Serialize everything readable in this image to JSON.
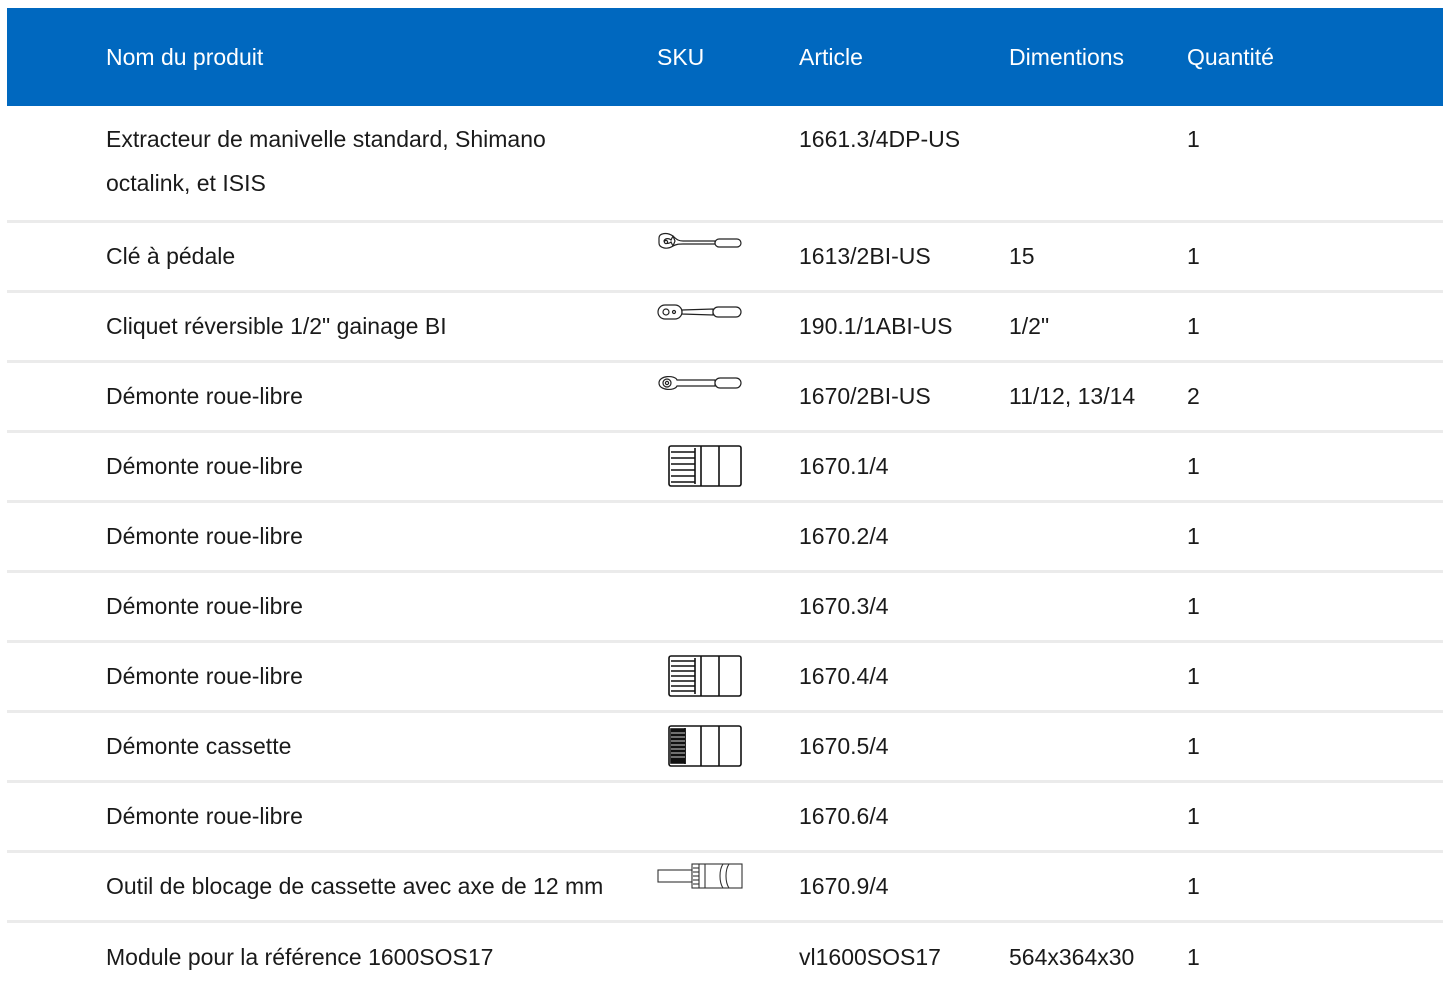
{
  "table": {
    "headers": {
      "name": "Nom du produit",
      "sku": "SKU",
      "article": "Article",
      "dimensions": "Dimentions",
      "quantity": "Quantité"
    },
    "header_color": "#0068bf",
    "rows": [
      {
        "name": "Extracteur de manivelle standard, Shimano octalink, et ISIS",
        "sku_image": "none",
        "article": "1661.3/4DP-US",
        "dimensions": "",
        "quantity": "1"
      },
      {
        "name": "Clé à pédale",
        "sku_image": "pedal-wrench-icon",
        "article": "1613/2BI-US",
        "dimensions": "15",
        "quantity": "1"
      },
      {
        "name": "Cliquet réversible 1/2\" gainage BI",
        "sku_image": "ratchet-icon",
        "article": "190.1/1ABI-US",
        "dimensions": "1/2\"",
        "quantity": "1"
      },
      {
        "name": "Démonte roue-libre",
        "sku_image": "freewheel-wrench-icon",
        "article": "1670/2BI-US",
        "dimensions": "11/12, 13/14",
        "quantity": "2"
      },
      {
        "name": "Démonte roue-libre",
        "sku_image": "freewheel-socket-icon",
        "article": "1670.1/4",
        "dimensions": "",
        "quantity": "1"
      },
      {
        "name": "Démonte roue-libre",
        "sku_image": "none",
        "article": "1670.2/4",
        "dimensions": "",
        "quantity": "1"
      },
      {
        "name": "Démonte roue-libre",
        "sku_image": "none",
        "article": "1670.3/4",
        "dimensions": "",
        "quantity": "1"
      },
      {
        "name": "Démonte roue-libre",
        "sku_image": "freewheel-socket-icon",
        "article": "1670.4/4",
        "dimensions": "",
        "quantity": "1"
      },
      {
        "name": "Démonte cassette",
        "sku_image": "cassette-socket-icon",
        "article": "1670.5/4",
        "dimensions": "",
        "quantity": "1"
      },
      {
        "name": "Démonte roue-libre",
        "sku_image": "none",
        "article": "1670.6/4",
        "dimensions": "",
        "quantity": "1"
      },
      {
        "name": "Outil de blocage de cassette avec axe de 12 mm",
        "sku_image": "cassette-lockring-tool-icon",
        "article": "1670.9/4",
        "dimensions": "",
        "quantity": "1"
      },
      {
        "name": "Module pour la référence 1600SOS17",
        "sku_image": "none",
        "article": "vl1600SOS17",
        "dimensions": "564x364x30",
        "quantity": "1"
      }
    ]
  }
}
